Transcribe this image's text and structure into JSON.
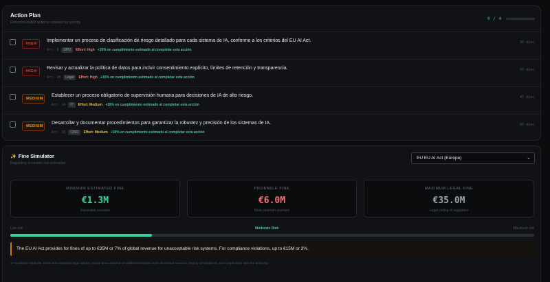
{
  "action_plan": {
    "title": "Action Plan",
    "subtitle": "Recommended actions ordered by priority",
    "count": "0 / 4",
    "progress": 0,
    "items": [
      {
        "severity": "HIGH",
        "title": "Implementar un proceso de clasificación de riesgo detallado para cada sistema de IA, conforme a los criterios del EU AI Act.",
        "article": "Art. 6",
        "owner": "DPO",
        "effort": "Effort: High",
        "impact": "+15% en cumplimiento estimado al completar esta acción",
        "days": "30 días"
      },
      {
        "severity": "HIGH",
        "title": "Revisar y actualizar la política de datos para incluir consentimiento explícito, límites de retención y transparencia.",
        "article": "Art. 10",
        "owner": "Legal",
        "effort": "Effort: High",
        "impact": "+15% en cumplimiento estimado al completar esta acción",
        "days": "45 días"
      },
      {
        "severity": "MEDIUM",
        "title": "Establecer un proceso obligatorio de supervisión humana para decisiones de IA de alto riesgo.",
        "article": "Art. 14",
        "owner": "IT",
        "effort": "Effort: Medium",
        "impact": "+10% en cumplimiento estimado al completar esta acción",
        "days": "47 días"
      },
      {
        "severity": "MEDIUM",
        "title": "Desarrollar y documentar procedimientos para garantizar la robustez y precisión de los sistemas de IA.",
        "article": "Art. 15",
        "owner": "CISO",
        "effort": "Effort: Medium",
        "impact": "+10% en cumplimiento estimado al completar esta acción",
        "days": "60 días"
      }
    ]
  },
  "fine_simulator": {
    "icon": "sparkle-icon",
    "title": "Fine Simulator",
    "subtitle": "Regulatory economic risk estimation",
    "regulation_select": "EU EU AI Act (Europe)",
    "cards": [
      {
        "label": "MINIMUM ESTIMATED FINE",
        "value": "€1.3M",
        "note": "Favorable scenario",
        "color": "#34d399"
      },
      {
        "label": "PROBABLE FINE",
        "value": "€6.0M",
        "note": "Most common scenario",
        "color": "#f87171"
      },
      {
        "label": "MAXIMUM LEGAL FINE",
        "value": "€35.0M",
        "note": "Legal ceiling of regulation",
        "color": "#9ca3af"
      }
    ],
    "risk_low_label": "Low risk",
    "risk_mid_label": "Moderate Risk",
    "risk_max_label": "Maximum risk",
    "risk_level": 0.27,
    "info_note": "The EU AI Act provides for fines of up to €35M or 7% of global revenue for unacceptable risk systems. For compliance violations, up to €15M or 3%.",
    "disclaimer": "⊙ Guidance estimate. Does not constitute legal advice. Actual fines depend on additional factors such as annual revenue, history of violations, and cooperation with the authority."
  },
  "colors": {
    "accent": "#34d399",
    "high": "#ef4444",
    "medium": "#f59e0b",
    "background": "#0b0c0e"
  }
}
